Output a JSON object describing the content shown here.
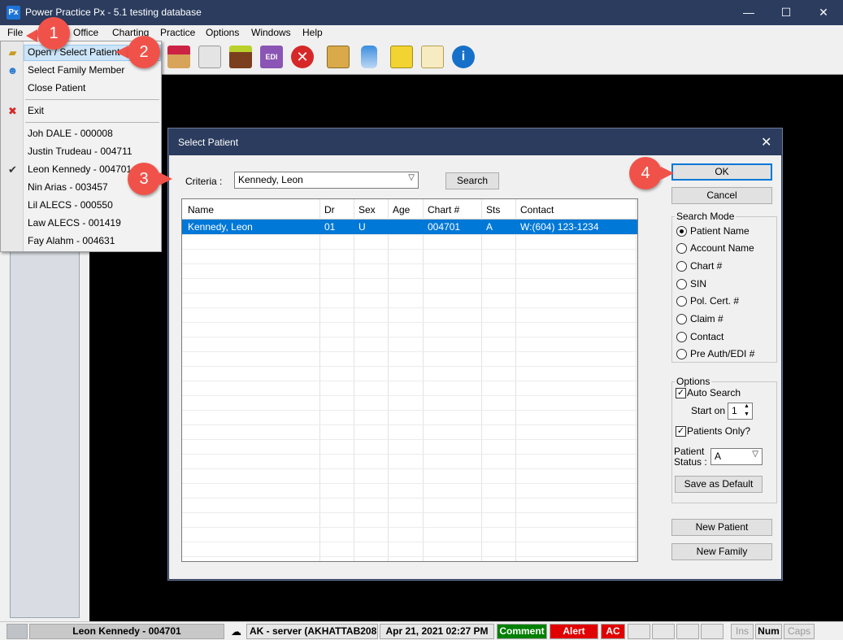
{
  "window": {
    "app_icon_text": "Px",
    "title": "Power Practice Px - 5.1 testing database",
    "minimize": "—",
    "maximize": "☐",
    "close": "✕"
  },
  "menubar": {
    "file": "File",
    "office": "Office",
    "charting": "Charting",
    "practice": "Practice",
    "options": "Options",
    "windows": "Windows",
    "help": "Help"
  },
  "file_menu": {
    "open_select_patient": "Open / Select Patient",
    "select_family_member": "Select Family Member",
    "close_patient": "Close Patient",
    "exit": "Exit",
    "recent_patients": [
      "Joh DALE - 000008",
      "Justin Trudeau - 004711",
      "Leon Kennedy - 004701",
      "Nin Arias - 003457",
      "Lil ALECS - 000550",
      "Law ALECS - 001419",
      "Fay Alahm - 004631"
    ],
    "checked_patient_index": 2
  },
  "dialog": {
    "title": "Select Patient",
    "close": "✕",
    "criteria_label": "Criteria :",
    "criteria_value": "Kennedy, Leon",
    "search_button": "Search",
    "ok_button": "OK",
    "cancel_button": "Cancel",
    "columns": [
      "Name",
      "Dr",
      "Sex",
      "Age",
      "Chart #",
      "Sts",
      "Contact"
    ],
    "rows": [
      [
        "Kennedy, Leon",
        "01",
        "U",
        "",
        "004701",
        "A",
        "W:(604) 123-1234"
      ]
    ],
    "search_mode": {
      "title": "Search Mode",
      "options": [
        "Patient Name",
        "Account Name",
        "Chart #",
        "SIN",
        "Pol. Cert. #",
        "Claim #",
        "Contact",
        "Pre Auth/EDI #"
      ],
      "selected_index": 0
    },
    "options_group": {
      "title": "Options",
      "auto_search": "Auto Search",
      "auto_search_checked": true,
      "start_on_label": "Start on",
      "start_on_value": "1",
      "patients_only": "Patients Only?",
      "patients_only_checked": true,
      "patient_status_label_1": "Patient",
      "patient_status_label_2": "Status :",
      "patient_status_value": "A",
      "save_default": "Save as Default"
    },
    "new_patient_button": "New Patient",
    "new_family_button": "New Family"
  },
  "callouts": [
    "1",
    "2",
    "3",
    "4"
  ],
  "statusbar": {
    "patient": "Leon Kennedy - 004701",
    "server": "AK - server (AKHATTAB208",
    "datetime": "Apr 21, 2021 02:27 PM",
    "comment": "Comment",
    "alert": "Alert",
    "ac": "AC",
    "ins": "Ins",
    "num": "Num",
    "caps": "Caps"
  },
  "colors": {
    "titlebar": "#2b3c5e",
    "selection": "#0078d7",
    "callout": "#f0524a",
    "comment_bg": "#008000",
    "alert_bg": "#e00000"
  }
}
